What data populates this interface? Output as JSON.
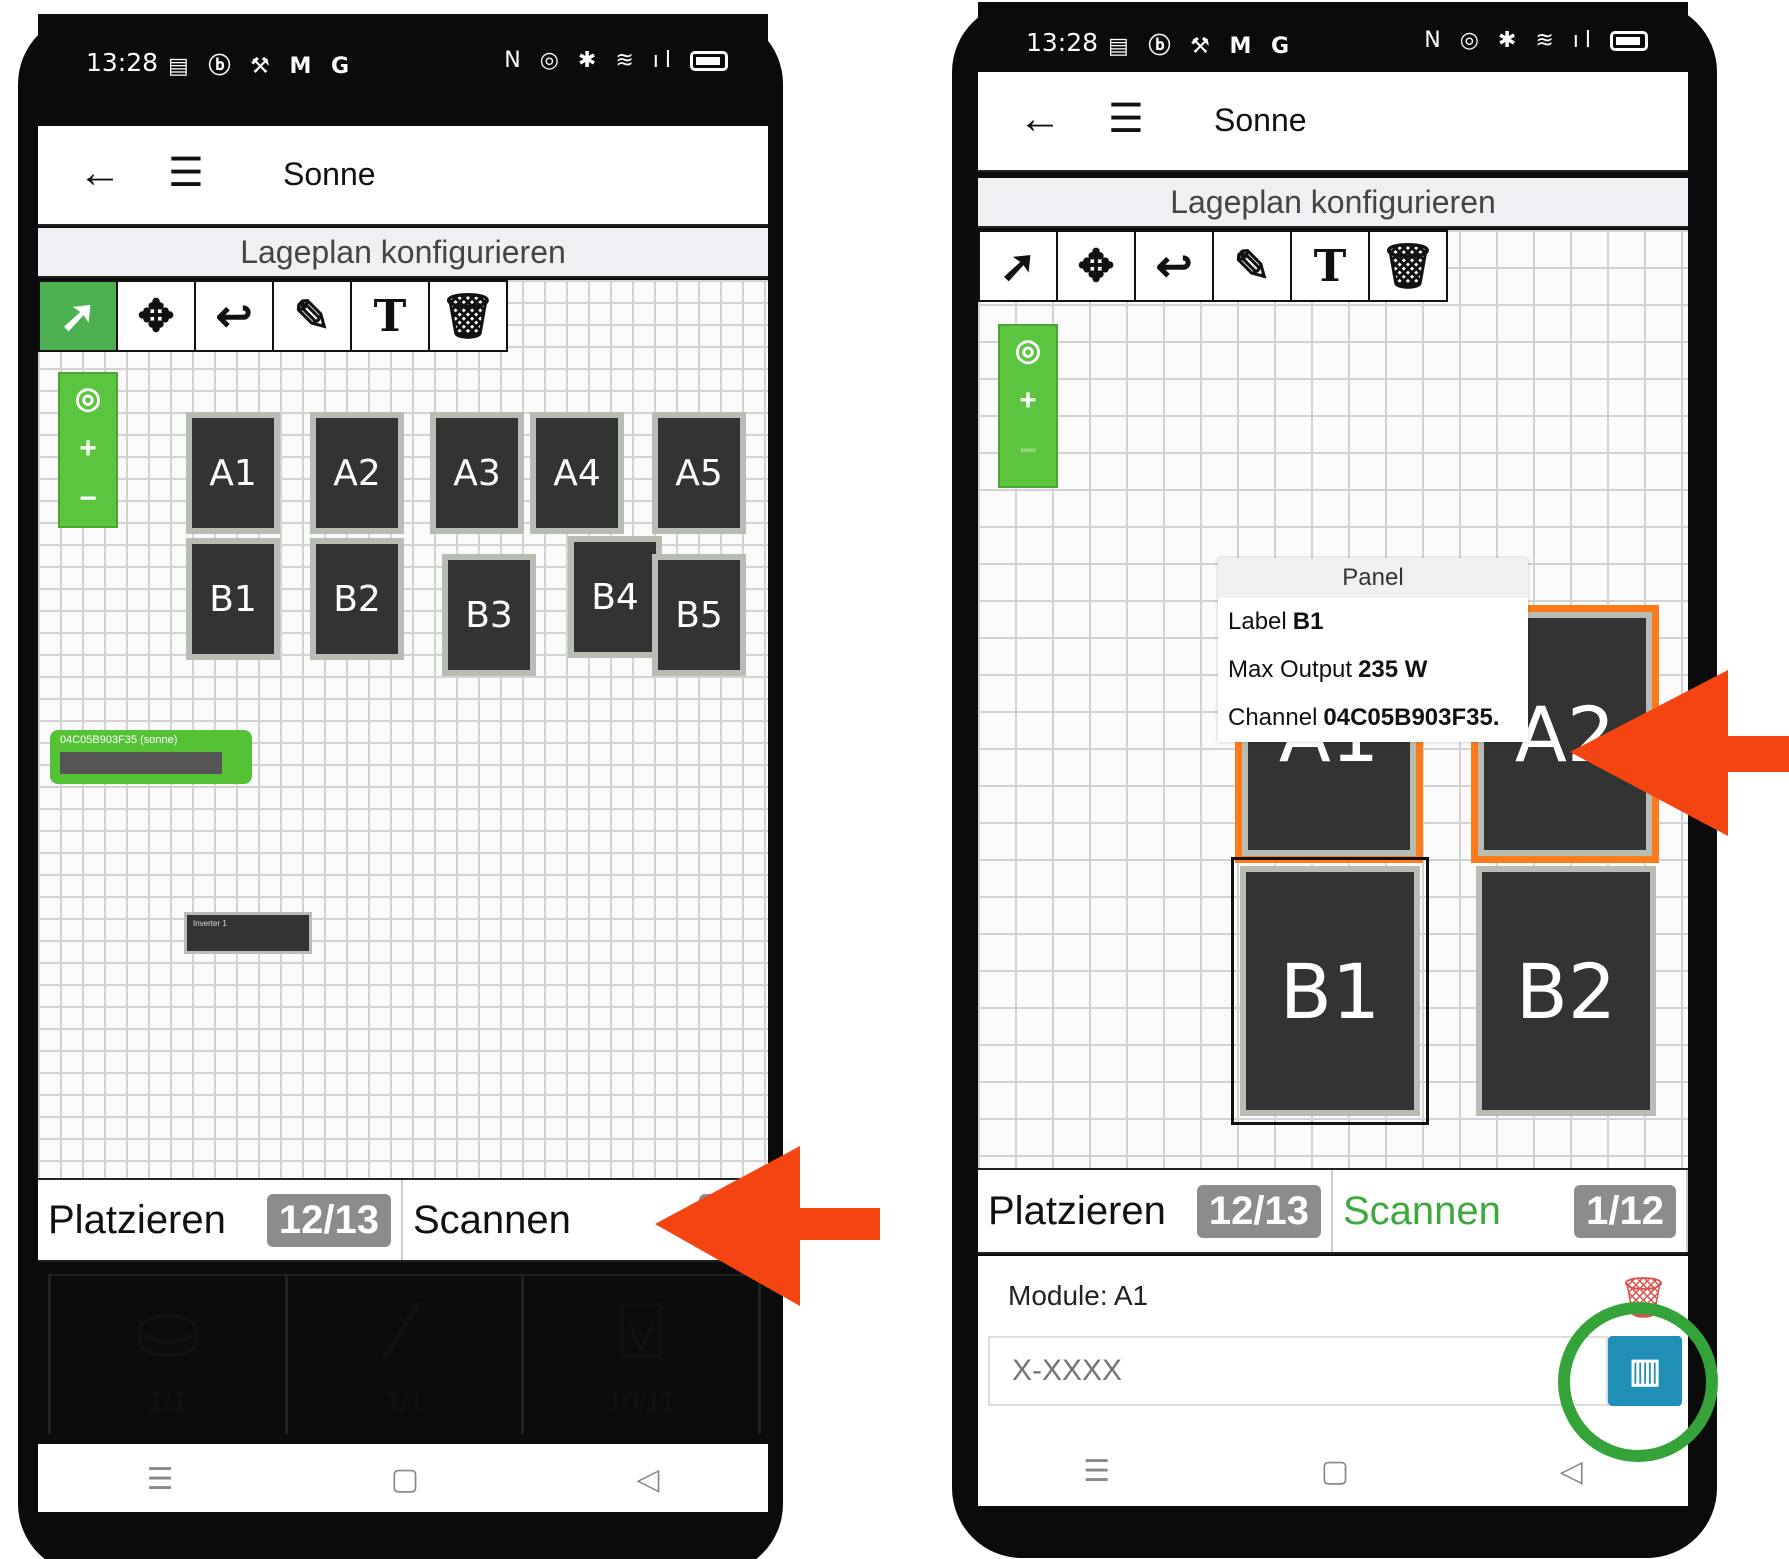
{
  "left_phone": {
    "status_time": "13:28",
    "app_title": "Sonne",
    "subtitle": "Lageplan konfigurieren",
    "tools": [
      "cursor-icon",
      "move-icon",
      "undo-icon",
      "pencil-icon",
      "text-icon",
      "trash-icon"
    ],
    "panels": [
      "A1",
      "A2",
      "A3",
      "A4",
      "A5",
      "B1",
      "B2",
      "B3",
      "B4",
      "B5"
    ],
    "gateway_label": "04C05B903F35 (sonne)",
    "inverter_label": "Inverter 1",
    "tabs": {
      "place_label": "Platzieren",
      "place_count": "12/13",
      "scan_label": "Scannen",
      "scan_count": "1/"
    },
    "summary": [
      {
        "icon": "drive-icon",
        "value": "1/1"
      },
      {
        "icon": "inverter-icon",
        "value": "1/1"
      },
      {
        "icon": "panel-icon",
        "value": "10/11"
      }
    ]
  },
  "right_phone": {
    "status_time": "13:28",
    "app_title": "Sonne",
    "subtitle": "Lageplan konfigurieren",
    "panels": [
      "A1",
      "A2",
      "B1",
      "B2"
    ],
    "tooltip": {
      "title": "Panel",
      "label_key": "Label",
      "label_val": "B1",
      "output_key": "Max Output",
      "output_val": "235 W",
      "channel_key": "Channel",
      "channel_val": "04C05B903F35."
    },
    "tabs": {
      "place_label": "Platzieren",
      "place_count": "12/13",
      "scan_label": "Scannen",
      "scan_count": "1/12"
    },
    "module_label": "Module: A1",
    "module_placeholder": "X-XXXX"
  },
  "colors": {
    "accent_green": "#4caf50",
    "arrow": "#f44412",
    "highlight_circle": "#33a33a",
    "selection": "#ff7a1a"
  }
}
